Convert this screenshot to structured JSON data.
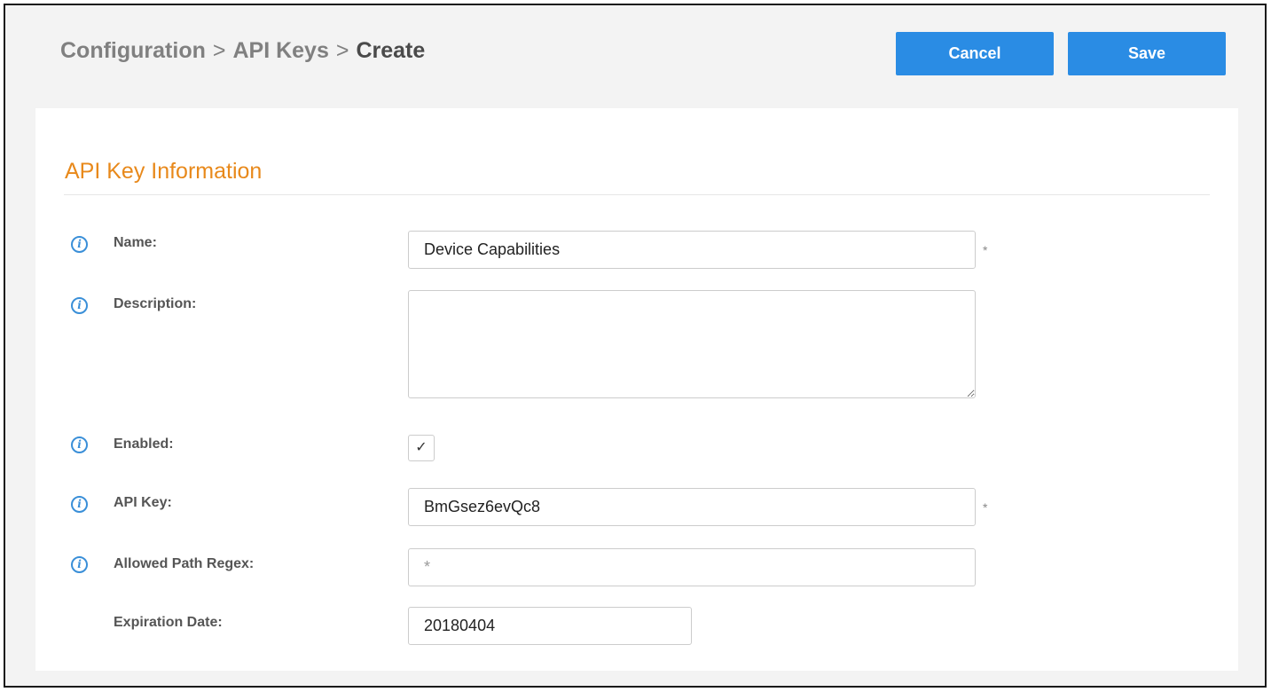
{
  "breadcrumb": {
    "items": [
      "Configuration",
      "API Keys",
      "Create"
    ],
    "separator": ">"
  },
  "actions": {
    "cancel_label": "Cancel",
    "save_label": "Save"
  },
  "section": {
    "title": "API Key Information"
  },
  "fields": {
    "name": {
      "label": "Name:",
      "value": "Device Capabilities",
      "required_mark": "*"
    },
    "description": {
      "label": "Description:",
      "value": ""
    },
    "enabled": {
      "label": "Enabled:",
      "checked": true,
      "check_glyph": "✓"
    },
    "api_key": {
      "label": "API Key:",
      "value": "BmGsez6evQc8",
      "required_mark": "*"
    },
    "allowed_path_regex": {
      "label": "Allowed Path Regex:",
      "placeholder": "*"
    },
    "expiration_date": {
      "label": "Expiration Date:",
      "value": "20180404"
    }
  },
  "icons": {
    "info": "info-circle-icon",
    "info_glyph": "i"
  },
  "colors": {
    "accent_button": "#2a8ce4",
    "section_title": "#e8891b",
    "info_icon": "#3a8fd8",
    "background": "#f3f3f3"
  }
}
